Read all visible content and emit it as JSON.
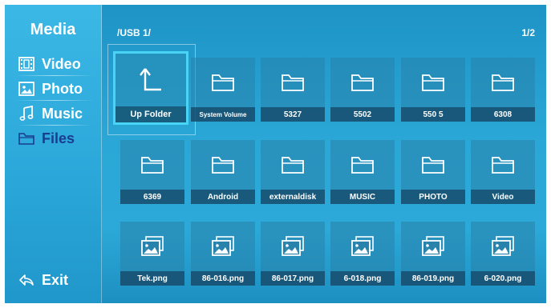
{
  "sidebar": {
    "title": "Media",
    "items": [
      {
        "label": "Video",
        "icon": "film-icon"
      },
      {
        "label": "Photo",
        "icon": "image-icon"
      },
      {
        "label": "Music",
        "icon": "music-note-icon"
      },
      {
        "label": "Files",
        "icon": "folder-icon",
        "active": true
      }
    ],
    "exit_label": "Exit"
  },
  "header": {
    "path": "/USB 1/",
    "page": "1/2"
  },
  "grid": {
    "up_folder": "Up Folder",
    "row1": [
      "System Volume",
      "5327",
      "5502",
      "550 5",
      "6308"
    ],
    "row2": [
      "6369",
      "Android",
      "externaldisk",
      "MUSIC",
      "PHOTO",
      "Video"
    ],
    "row3": [
      "Tek.png",
      "86-016.png",
      "86-017.png",
      "6-018.png",
      "86-019.png",
      "6-020.png"
    ]
  },
  "colors": {
    "accent": "#49d4f6",
    "active_text": "#1a3d8f"
  }
}
